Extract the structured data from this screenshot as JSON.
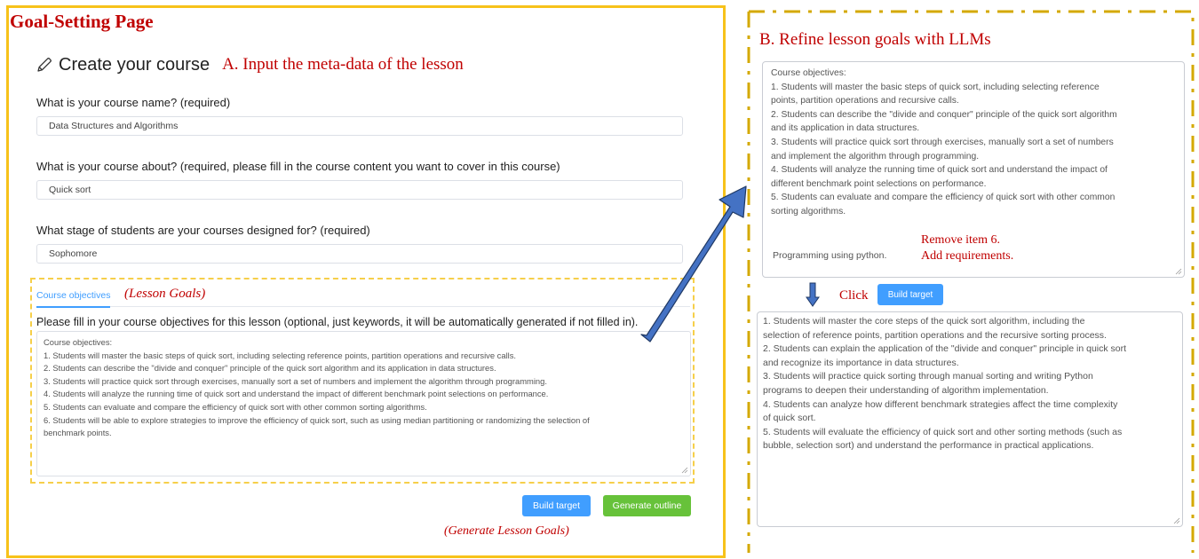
{
  "left": {
    "heading": "Goal-Setting Page",
    "create_title": "Create your course",
    "annotation_a": "A.   Input the meta-data of the lesson",
    "q1": {
      "label": "What is your course name? (required)",
      "value": "Data Structures and Algorithms"
    },
    "q2": {
      "label": "What is your course about? (required, please fill in the course content you want to cover in this course)",
      "value": "Quick sort"
    },
    "q3": {
      "label": "What stage of students are your courses designed for? (required)",
      "value": "Sophomore"
    },
    "tab_label": "Course objectives",
    "annotation_goals": "(Lesson Goals)",
    "objectives_prompt": "Please fill in your course objectives for this lesson (optional, just keywords, it will be automatically generated if not filled in).",
    "objectives_lines": [
      "Course objectives:",
      "1. Students will master the basic steps of quick sort, including selecting reference points, partition operations and recursive calls.",
      "2. Students can describe the \"divide and conquer\" principle of the quick sort algorithm and its application in data structures.",
      "3. Students will practice quick sort through exercises, manually sort a set of numbers and implement the algorithm through programming.",
      "4. Students will analyze the running time of quick sort and understand the impact of different benchmark point selections on performance.",
      "5. Students can evaluate and compare the efficiency of quick sort with other common sorting algorithms.",
      "6. Students will be able to explore strategies to improve the efficiency of quick sort, such as using median partitioning or randomizing the selection of",
      "benchmark points."
    ],
    "build_target_label": "Build target",
    "generate_outline_label": "Generate outline",
    "annotation_generate": "(Generate Lesson Goals)"
  },
  "right": {
    "annotation_b": "B.   Refine lesson goals with LLMs",
    "input_lines": [
      "Course objectives:",
      "1. Students will master the basic steps of quick sort, including selecting reference",
      "points, partition operations and recursive calls.",
      "2. Students can describe the \"divide and conquer\" principle of the quick sort algorithm",
      "and its application in data structures.",
      "3. Students will practice quick sort through exercises, manually sort a set of numbers",
      "and implement the algorithm through programming.",
      "4. Students will analyze the running time of quick sort and understand the impact of",
      "different benchmark point selections on performance.",
      "5. Students can evaluate and compare the efficiency of quick sort with other common",
      "sorting algorithms."
    ],
    "programming_note": "Programming using python.",
    "annotation_remove_1": "Remove item 6.",
    "annotation_remove_2": "Add requirements.",
    "click_label": "Click",
    "build_target_label": "Build target",
    "output_lines": [
      "1. Students will master the core steps of the quick sort algorithm, including the",
      "selection of reference points, partition operations and the recursive sorting process.",
      "2. Students can explain the application of the \"divide and conquer\" principle in quick sort",
      "and recognize its importance in data structures.",
      "3. Students will practice quick sorting through manual sorting and writing Python",
      "programs to deepen their understanding of algorithm implementation.",
      "4. Students can analyze how different benchmark strategies affect the time complexity",
      "of quick sort.",
      "5. Students will evaluate the efficiency of quick sort and other sorting methods (such as",
      "bubble, selection sort) and understand the performance in practical applications."
    ]
  },
  "colors": {
    "annotation_red": "#c00000",
    "left_border": "#f7c21a",
    "dash_border": "#d4a900",
    "arrow_fill": "#4472c4",
    "primary_button": "#409eff",
    "success_button": "#67c23a"
  },
  "icons": [
    "pencil-icon",
    "arrow-right-icon",
    "arrow-down-icon",
    "resize-handle-icon"
  ]
}
